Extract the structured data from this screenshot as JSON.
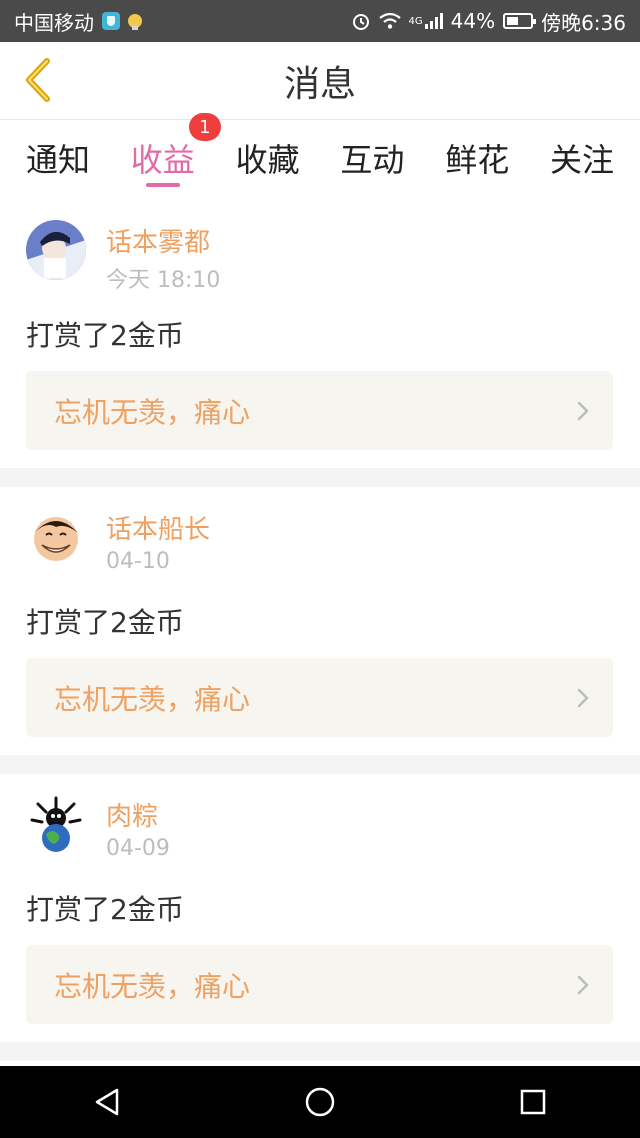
{
  "status_bar": {
    "carrier": "中国移动",
    "signal_label": "4G",
    "battery": "44%",
    "time": "傍晚6:36"
  },
  "header": {
    "title": "消息",
    "back_icon": "chevron-left-icon"
  },
  "tabs": [
    {
      "label": "通知",
      "active": false
    },
    {
      "label": "收益",
      "active": true,
      "badge": "1"
    },
    {
      "label": "收藏",
      "active": false
    },
    {
      "label": "互动",
      "active": false
    },
    {
      "label": "鲜花",
      "active": false
    },
    {
      "label": "关注",
      "active": false
    }
  ],
  "messages": [
    {
      "username": "话本雾都",
      "time": "今天 18:10",
      "action": "打赏了2金币",
      "quote": "忘机无羡，痛心",
      "avatar_icon": "avatar-character-icon"
    },
    {
      "username": "话本船长",
      "time": "04-10",
      "action": "打赏了2金币",
      "quote": "忘机无羡，痛心",
      "avatar_icon": "avatar-luffy-icon"
    },
    {
      "username": "肉粽",
      "time": "04-09",
      "action": "打赏了2金币",
      "quote": "忘机无羡，痛心",
      "avatar_icon": "avatar-globe-icon"
    }
  ],
  "colors": {
    "accent_pink": "#e46aa7",
    "username_orange": "#f0a060",
    "badge_red": "#ee3e3e",
    "quote_bg": "#f6f5ef"
  },
  "nav": {
    "back_icon": "triangle-back-icon",
    "home_icon": "circle-home-icon",
    "recent_icon": "square-recent-icon"
  }
}
